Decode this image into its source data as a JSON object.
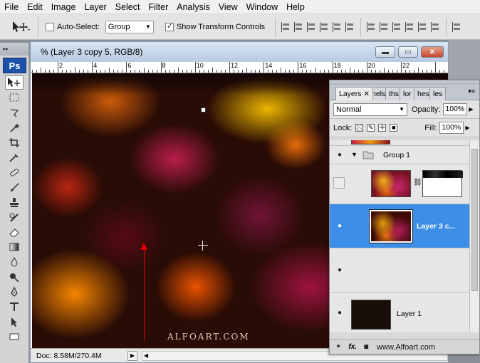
{
  "menu": [
    "File",
    "Edit",
    "Image",
    "Layer",
    "Select",
    "Filter",
    "Analysis",
    "View",
    "Window",
    "Help"
  ],
  "options": {
    "auto_select_label": "Auto-Select:",
    "auto_select_checked": false,
    "auto_select_value": "Group",
    "transform_label": "Show Transform Controls",
    "transform_checked": true
  },
  "tools": {
    "logo": "Ps",
    "items": [
      "move-tool",
      "marquee-tool",
      "lasso-tool",
      "magic-wand-tool",
      "crop-tool",
      "eyedropper-tool",
      "healing-brush-tool",
      "brush-tool",
      "clone-stamp-tool",
      "history-brush-tool",
      "eraser-tool",
      "gradient-tool",
      "blur-tool",
      "dodge-tool",
      "pen-tool",
      "type-tool",
      "path-selection-tool",
      "shape-tool"
    ]
  },
  "document": {
    "title": "% (Layer 3 copy 5, RGB/8)",
    "ruler_numbers": [
      "2",
      "4",
      "6",
      "8",
      "10",
      "12",
      "14",
      "16",
      "18",
      "20",
      "22"
    ],
    "watermark": "ALFOART.COM",
    "status": "Doc: 8.58M/270.4M"
  },
  "layers_panel": {
    "tabs": [
      "Layers",
      "nels",
      "ths",
      "lor",
      "hes",
      "les"
    ],
    "blend_mode": "Normal",
    "opacity_label": "Opacity:",
    "opacity": "100%",
    "lock_label": "Lock:",
    "fill_label": "Fill:",
    "fill": "100%",
    "layers": [
      {
        "name": "Group 1",
        "visible": true,
        "type": "group"
      },
      {
        "name": "",
        "visible": false,
        "type": "masked"
      },
      {
        "name": "Layer 3 c...",
        "visible": true,
        "selected": true
      },
      {
        "name": "",
        "visible": true
      },
      {
        "name": "Layer 1",
        "visible": true
      }
    ],
    "site": "www.Alfoart.com"
  }
}
